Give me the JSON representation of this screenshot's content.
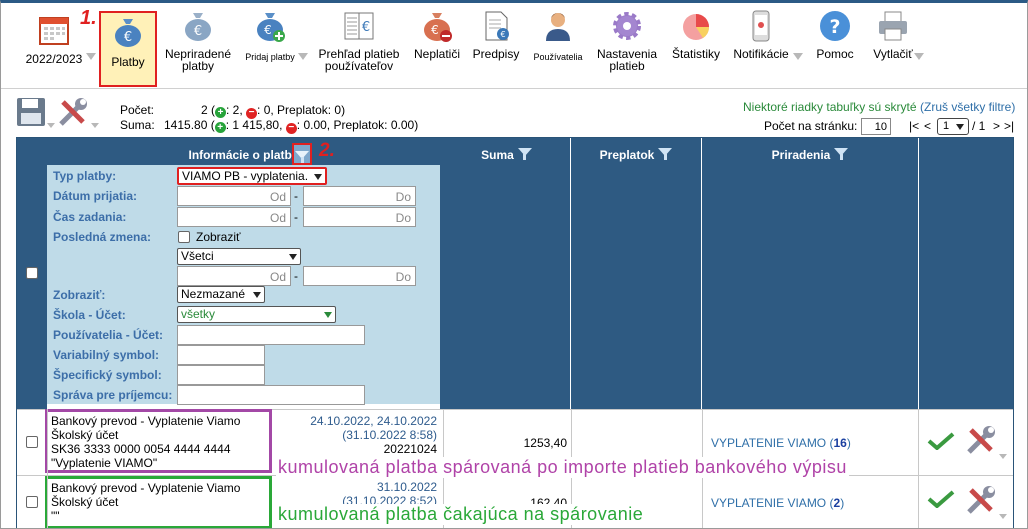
{
  "toolbar": {
    "year": "2022/2023",
    "platby": "Platby",
    "nepriradene": "Nepriradené platby",
    "pridaj": "Pridaj platby",
    "prehlad": "Prehľad platieb používateľov",
    "neplatici": "Neplatiči",
    "predpisy": "Predpisy",
    "pouzivatelia": "Používatelia",
    "nastavenia": "Nastavenia platieb",
    "statistiky": "Štatistiky",
    "notifikacie": "Notifikácie",
    "pomoc": "Pomoc",
    "vytlacit": "Vytlačiť",
    "annotation1": "1.",
    "annotation2": "2."
  },
  "summary": {
    "pocet_label": "Počet:",
    "pocet_value": "2 (",
    "pocet_plus": ": 2,",
    "pocet_minus": ": 0, Preplatok: 0)",
    "suma_label": "Suma:",
    "suma_value": "1415.80 (",
    "suma_plus": ": 1 415,80,",
    "suma_minus": ": 0.00, Preplatok: 0.00)",
    "hidden_rows": "Niektoré riadky tabuľky sú skryté",
    "clear_filters": "(Zruš všetky filtre)",
    "per_page_label": "Počet na stránku:",
    "per_page": "10",
    "pager_first": "|<",
    "pager_prev": "<",
    "page": "1",
    "of_pages": "/ 1",
    "pager_next": ">",
    "pager_last": ">|"
  },
  "table": {
    "col_info": "Informácie o platbe",
    "col_suma": "Suma",
    "col_preplatok": "Preplatok",
    "col_priradenia": "Priradenia"
  },
  "filters": {
    "typ_platby": "Typ platby:",
    "typ_platby_value": "VIAMO PB - vyplatenia.",
    "datum_prijatia": "Dátum prijatia:",
    "cas_zadania": "Čas zadania:",
    "od": "Od",
    "do": "Do",
    "dash": "-",
    "posledna_zmena": "Posledná zmena:",
    "zobrazit_cb": "Zobraziť",
    "vsetci": "Všetci",
    "zobrazit": "Zobraziť:",
    "zobrazit_value": "Nezmazané",
    "skola_ucet": "Škola - Účet:",
    "skola_value": "všetky",
    "pouzivatelia_ucet": "Používatelia - Účet:",
    "variabilny": "Variabilný symbol:",
    "specificky": "Špecifický symbol:",
    "sprava": "Správa pre príjemcu:"
  },
  "rows": [
    {
      "line1": "Bankový prevod - Vyplatenie Viamo",
      "line2": "Školský účet",
      "line3": "SK36 3333 0000 0054 4444 4444",
      "line4": "\"Vyplatenie VIAMO\"",
      "date1": "24.10.2022, 24.10.2022",
      "date2": "(31.10.2022 8:58)",
      "vs": "20221024",
      "suma": "1253,40",
      "priradenie": "VYPLATENIE VIAMO",
      "count": "16",
      "note": "kumulovaná platba spárovaná po importe platieb bankového výpisu"
    },
    {
      "line1": "Bankový prevod - Vyplatenie Viamo",
      "line2": "Školský účet",
      "line3": "\"\"",
      "date1": "31.10.2022",
      "date2": "(31.10.2022 8:52)",
      "suma": "162,40",
      "priradenie": "VYPLATENIE VIAMO",
      "count": "2",
      "note": "kumulovaná platba čakajúca na spárovanie"
    }
  ],
  "colors": {
    "header": "#2e5a82",
    "filter_bg": "#bfdbe8",
    "highlight_red": "#e02020",
    "note_purple": "#b043a8",
    "note_green": "#2aa838",
    "check_green": "#3a9a40"
  }
}
